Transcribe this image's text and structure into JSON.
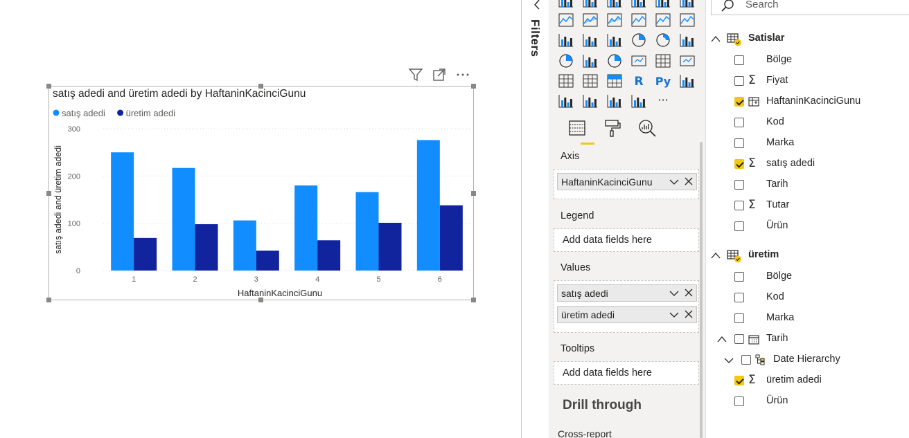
{
  "colors": {
    "accent": "#f2c811",
    "series1": "#118dff",
    "series2": "#12239e"
  },
  "filters": {
    "label": "Filters"
  },
  "visual_header": {
    "filter_icon": "filter-icon",
    "focus_icon": "focus-mode-icon",
    "more_icon": "more-options-icon"
  },
  "chart_data": {
    "type": "bar",
    "title": "satış adedi and üretim adedi by HaftaninKacinciGunu",
    "xlabel": "HaftaninKacinciGunu",
    "ylabel": "satış adedi and üretim adedi",
    "categories": [
      "1",
      "2",
      "3",
      "4",
      "5",
      "6"
    ],
    "series": [
      {
        "name": "satış adedi",
        "color": "#118dff",
        "values": [
          250,
          217,
          106,
          180,
          166,
          276
        ]
      },
      {
        "name": "üretim adedi",
        "color": "#12239e",
        "values": [
          69,
          98,
          42,
          64,
          101,
          138
        ]
      }
    ],
    "ylim": [
      0,
      300
    ],
    "yticks": [
      "0",
      "100",
      "200",
      "300"
    ],
    "grid": true,
    "legend": "top-left"
  },
  "visualizations": {
    "icons": [
      "stacked-bar-icon",
      "clustered-bar-icon",
      "stacked-column-icon",
      "clustered-column-icon",
      "100-bar-icon",
      "100-column-icon",
      "line-chart-icon",
      "area-chart-icon",
      "stacked-area-icon",
      "line-column-icon",
      "line-clustered-column-icon",
      "ribbon-chart-icon",
      "waterfall-icon",
      "funnel-icon",
      "scatter-icon",
      "pie-chart-icon",
      "donut-chart-icon",
      "treemap-icon",
      "map-icon",
      "filled-map-icon",
      "gauge-icon",
      "card-icon",
      "multi-row-card-icon",
      "kpi-icon",
      "slicer-icon",
      "table-icon",
      "matrix-icon",
      "r-visual-icon",
      "python-visual-icon",
      "key-influencers-icon",
      "decomposition-tree-icon",
      "qa-icon",
      "smart-narrative-icon",
      "paginated-icon",
      "more-visuals-icon"
    ],
    "r_label": "R",
    "py_label": "Py",
    "more_label": "···",
    "tabs": [
      "fields-tab-icon",
      "format-tab-icon",
      "analytics-tab-icon"
    ],
    "wells": {
      "axis": {
        "title": "Axis",
        "fields": [
          "HaftaninKacinciGunu"
        ]
      },
      "legend": {
        "title": "Legend",
        "placeholder": "Add data fields here"
      },
      "values": {
        "title": "Values",
        "fields": [
          "satış adedi",
          "üretim adedi"
        ]
      },
      "tooltips": {
        "title": "Tooltips",
        "placeholder": "Add data fields here"
      }
    },
    "drill_through": "Drill through",
    "cross_report": "Cross-report"
  },
  "fields": {
    "search_placeholder": "Search",
    "tables": [
      {
        "name": "Satislar",
        "fields": [
          {
            "name": "Bölge",
            "checked": false,
            "icon": ""
          },
          {
            "name": "Fiyat",
            "checked": false,
            "icon": "sigma"
          },
          {
            "name": "HaftaninKacinciGunu",
            "checked": true,
            "icon": "calculated-column"
          },
          {
            "name": "Kod",
            "checked": false,
            "icon": ""
          },
          {
            "name": "Marka",
            "checked": false,
            "icon": ""
          },
          {
            "name": "satış adedi",
            "checked": true,
            "icon": "sigma"
          },
          {
            "name": "Tarih",
            "checked": false,
            "icon": ""
          },
          {
            "name": "Tutar",
            "checked": false,
            "icon": "sigma"
          },
          {
            "name": "Ürün",
            "checked": false,
            "icon": ""
          }
        ]
      },
      {
        "name": "üretim",
        "fields": [
          {
            "name": "Bölge",
            "checked": false,
            "icon": ""
          },
          {
            "name": "Kod",
            "checked": false,
            "icon": ""
          },
          {
            "name": "Marka",
            "checked": false,
            "icon": ""
          },
          {
            "name": "Tarih",
            "checked": false,
            "icon": "calendar"
          },
          {
            "name": "Date Hierarchy",
            "checked": false,
            "icon": "hierarchy"
          },
          {
            "name": "üretim adedi",
            "checked": true,
            "icon": "sigma"
          },
          {
            "name": "Ürün",
            "checked": false,
            "icon": ""
          }
        ]
      }
    ]
  }
}
